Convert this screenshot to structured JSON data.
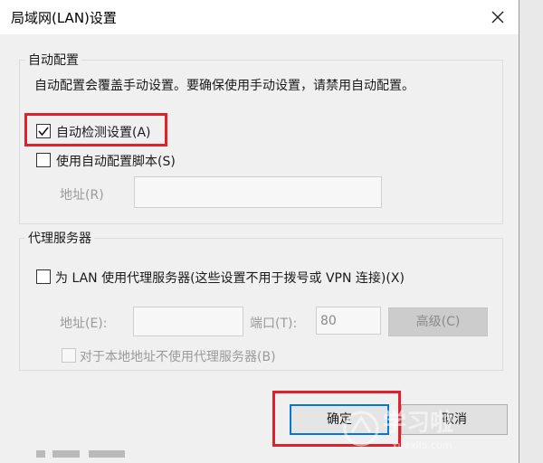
{
  "window": {
    "title": "局域网(LAN)设置"
  },
  "auto_config": {
    "group_label": "自动配置",
    "description": "自动配置会覆盖手动设置。要确保使用手动设置，请禁用自动配置。",
    "auto_detect": {
      "label": "自动检测设置(A)",
      "checked": true
    },
    "use_script": {
      "label": "使用自动配置脚本(S)",
      "checked": false
    },
    "address_label": "地址(R)",
    "address_value": ""
  },
  "proxy": {
    "group_label": "代理服务器",
    "use_proxy": {
      "label": "为 LAN 使用代理服务器(这些设置不用于拨号或 VPN 连接)(X)",
      "checked": false
    },
    "address_label": "地址(E):",
    "address_value": "",
    "port_label": "端口(T):",
    "port_value": "80",
    "advanced_label": "高级(C)",
    "bypass_local": {
      "label": "对于本地地址不使用代理服务器(B)",
      "checked": false
    }
  },
  "buttons": {
    "ok_label": "确定",
    "cancel_label": "取消"
  },
  "watermark": {
    "text": "学习啦",
    "url": "xuexila.com"
  },
  "colors": {
    "highlight": "#e0202a",
    "focus": "#0078d7"
  }
}
